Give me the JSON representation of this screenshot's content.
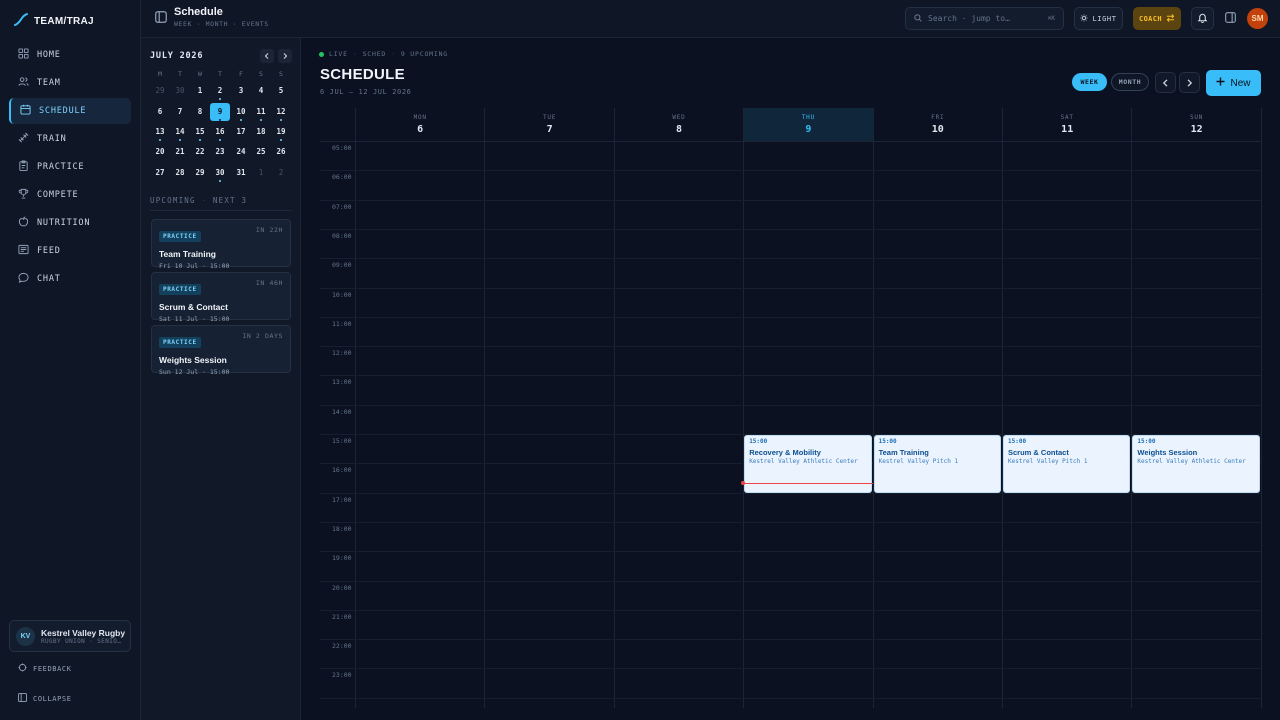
{
  "brand": {
    "name": "TEAM/TRAJ"
  },
  "nav": [
    {
      "label": "HOME",
      "icon": "grid-icon",
      "active": false
    },
    {
      "label": "TEAM",
      "icon": "users-icon",
      "active": false
    },
    {
      "label": "SCHEDULE",
      "icon": "calendar-icon",
      "active": true
    },
    {
      "label": "TRAIN",
      "icon": "dumbbell-icon",
      "active": false
    },
    {
      "label": "PRACTICE",
      "icon": "clipboard-icon",
      "active": false
    },
    {
      "label": "COMPETE",
      "icon": "trophy-icon",
      "active": false
    },
    {
      "label": "NUTRITION",
      "icon": "apple-icon",
      "active": false
    },
    {
      "label": "FEED",
      "icon": "newspaper-icon",
      "active": false
    },
    {
      "label": "CHAT",
      "icon": "chat-icon",
      "active": false
    }
  ],
  "team": {
    "initials": "KV",
    "name": "Kestrel Valley Rugby",
    "sub": "RUGBY UNION · SENIOR …"
  },
  "footer": {
    "feedback": "FEEDBACK",
    "collapse": "COLLAPSE"
  },
  "topbar": {
    "title": "Schedule",
    "subtitle": "WEEK · MONTH · EVENTS",
    "search_placeholder": "Search · jump to…",
    "search_shortcut": "⌘K",
    "light_label": "LIGHT",
    "coach_label": "COACH",
    "user_initials": "SM"
  },
  "mini_calendar": {
    "title": "JULY 2026",
    "weekdays": [
      "M",
      "T",
      "W",
      "T",
      "F",
      "S",
      "S"
    ],
    "weeks": [
      [
        {
          "d": "29",
          "m": true
        },
        {
          "d": "30",
          "m": true
        },
        {
          "d": "1"
        },
        {
          "d": "2",
          "dot": true
        },
        {
          "d": "3"
        },
        {
          "d": "4"
        },
        {
          "d": "5"
        }
      ],
      [
        {
          "d": "6"
        },
        {
          "d": "7"
        },
        {
          "d": "8"
        },
        {
          "d": "9",
          "today": true,
          "dot": true
        },
        {
          "d": "10",
          "dot": true
        },
        {
          "d": "11",
          "dot": true
        },
        {
          "d": "12",
          "dot": true
        }
      ],
      [
        {
          "d": "13",
          "dot": true
        },
        {
          "d": "14",
          "dot": true
        },
        {
          "d": "15",
          "dot": true
        },
        {
          "d": "16",
          "dot": true
        },
        {
          "d": "17"
        },
        {
          "d": "18"
        },
        {
          "d": "19",
          "dot": true
        }
      ],
      [
        {
          "d": "20"
        },
        {
          "d": "21"
        },
        {
          "d": "22"
        },
        {
          "d": "23"
        },
        {
          "d": "24"
        },
        {
          "d": "25"
        },
        {
          "d": "26"
        }
      ],
      [
        {
          "d": "27"
        },
        {
          "d": "28"
        },
        {
          "d": "29"
        },
        {
          "d": "30",
          "dot": true
        },
        {
          "d": "31"
        },
        {
          "d": "1",
          "m": true
        },
        {
          "d": "2",
          "m": true
        }
      ]
    ]
  },
  "upcoming": {
    "label": "UPCOMING",
    "sublabel": "NEXT 3",
    "items": [
      {
        "badge": "PRACTICE",
        "when": "IN 22H",
        "title": "Team Training",
        "time": "Fri 10 Jul · 15:00"
      },
      {
        "badge": "PRACTICE",
        "when": "IN 46H",
        "title": "Scrum & Contact",
        "time": "Sat 11 Jul · 15:00"
      },
      {
        "badge": "PRACTICE",
        "when": "IN 2 DAYS",
        "title": "Weights Session",
        "time": "Sun 12 Jul · 15:00"
      }
    ]
  },
  "schedule": {
    "live": "LIVE",
    "sched": "SCHED",
    "upcoming_count": "9 UPCOMING",
    "title": "SCHEDULE",
    "range": "6 JUL — 12 JUL 2026",
    "week_label": "WEEK",
    "month_label": "MONTH",
    "new_label": "New",
    "days": [
      {
        "name": "MON",
        "num": "6"
      },
      {
        "name": "TUE",
        "num": "7"
      },
      {
        "name": "WED",
        "num": "8"
      },
      {
        "name": "THU",
        "num": "9",
        "today": true
      },
      {
        "name": "FRI",
        "num": "10"
      },
      {
        "name": "SAT",
        "num": "11"
      },
      {
        "name": "SUN",
        "num": "12"
      }
    ],
    "hours": [
      "05:00",
      "06:00",
      "07:00",
      "08:00",
      "09:00",
      "10:00",
      "11:00",
      "12:00",
      "13:00",
      "14:00",
      "15:00",
      "16:00",
      "17:00",
      "18:00",
      "19:00",
      "20:00",
      "21:00",
      "22:00",
      "23:00"
    ],
    "events": [
      {
        "day": 3,
        "start": "15:00",
        "end": "17:00",
        "time": "15:00",
        "title": "Recovery & Mobility",
        "location": "Kestrel Valley Athletic Center"
      },
      {
        "day": 4,
        "start": "15:00",
        "end": "17:00",
        "time": "15:00",
        "title": "Team Training",
        "location": "Kestrel Valley Pitch 1"
      },
      {
        "day": 5,
        "start": "15:00",
        "end": "17:00",
        "time": "15:00",
        "title": "Scrum & Contact",
        "location": "Kestrel Valley Pitch 1"
      },
      {
        "day": 6,
        "start": "15:00",
        "end": "17:00",
        "time": "15:00",
        "title": "Weights Session",
        "location": "Kestrel Valley Athletic Center"
      }
    ],
    "now": {
      "day": 3,
      "time": "16:40"
    }
  }
}
